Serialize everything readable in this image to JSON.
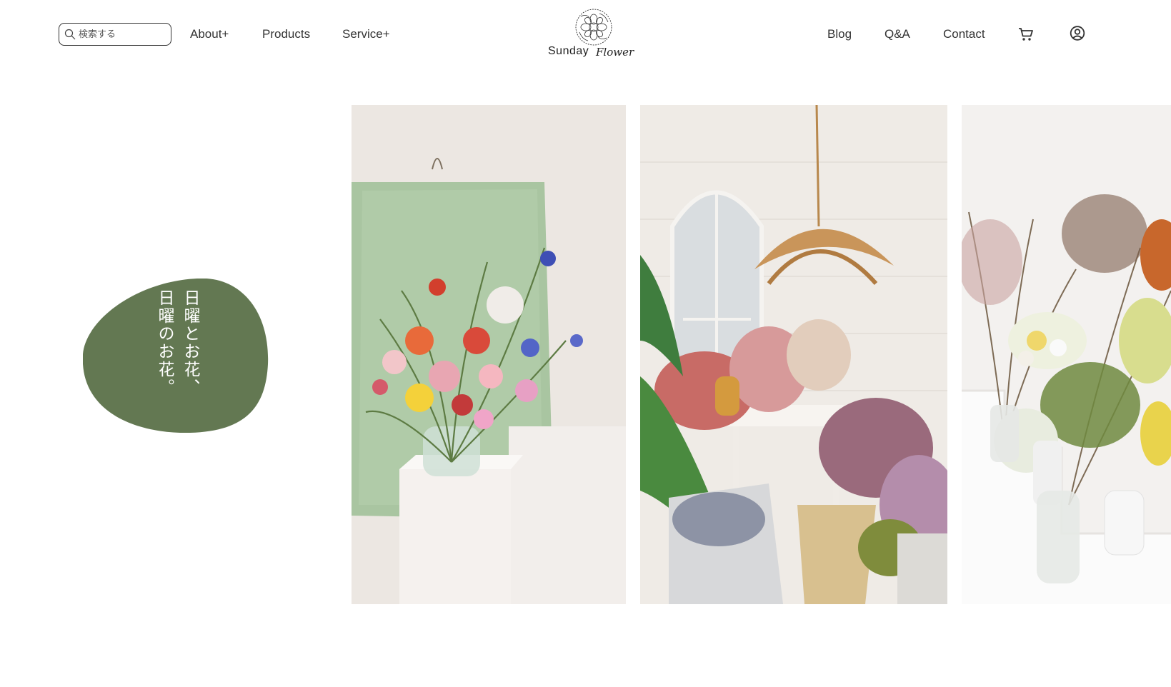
{
  "header": {
    "search": {
      "placeholder": "検索する",
      "icon": "search-icon"
    },
    "nav_left": [
      {
        "label": "About+"
      },
      {
        "label": "Products"
      },
      {
        "label": "Service+"
      }
    ],
    "logo": {
      "word": "Sunday",
      "script": "Flower"
    },
    "nav_right": [
      {
        "label": "Blog"
      },
      {
        "label": "Q&A"
      },
      {
        "label": "Contact"
      }
    ],
    "icons": {
      "cart": "cart-icon",
      "account": "account-icon"
    }
  },
  "hero": {
    "tagline_lines": [
      "日曜とお花、",
      "日曜のお花。"
    ],
    "blob_color": "#637852",
    "photos": [
      {
        "name": "bouquet-photo"
      },
      {
        "name": "dried-flowers-photo"
      },
      {
        "name": "vases-photo"
      }
    ]
  },
  "colors": {
    "accent": "#637852",
    "text": "#333333",
    "background": "#ffffff"
  }
}
